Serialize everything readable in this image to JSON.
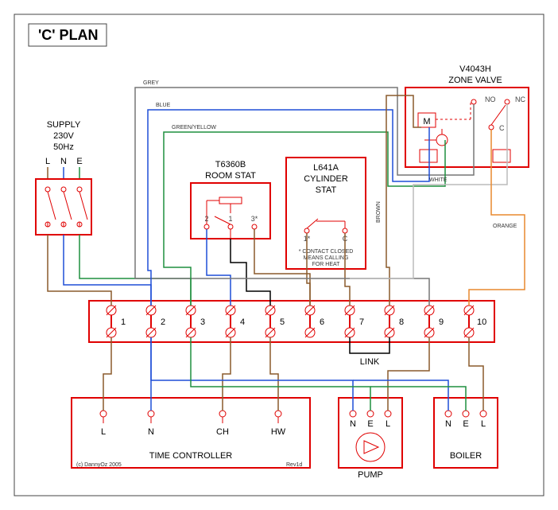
{
  "title": "'C' PLAN",
  "supply": {
    "label": "SUPPLY",
    "voltage": "230V",
    "freq": "50Hz",
    "L": "L",
    "N": "N",
    "E": "E"
  },
  "roomstat": {
    "label1": "T6360B",
    "label2": "ROOM STAT",
    "t1": "2",
    "t2": "1",
    "t3": "3*"
  },
  "cylstat": {
    "label1": "L641A",
    "label2": "CYLINDER",
    "label3": "STAT",
    "t1": "1*",
    "tC": "C",
    "note1": "* CONTACT CLOSED",
    "note2": "MEANS CALLING",
    "note3": "FOR HEAT"
  },
  "zone": {
    "label1": "V4043H",
    "label2": "ZONE VALVE",
    "M": "M",
    "NO": "NO",
    "NC": "NC",
    "C": "C"
  },
  "junction": {
    "terminals": [
      "1",
      "2",
      "3",
      "4",
      "5",
      "6",
      "7",
      "8",
      "9",
      "10"
    ],
    "link": "LINK"
  },
  "timecontroller": {
    "label": "TIME CONTROLLER",
    "L": "L",
    "N": "N",
    "CH": "CH",
    "HW": "HW",
    "copyright": "(c) DannyOz 2005",
    "rev": "Rev1d"
  },
  "pump": {
    "label": "PUMP",
    "N": "N",
    "E": "E",
    "L": "L"
  },
  "boiler": {
    "label": "BOILER",
    "N": "N",
    "E": "E",
    "L": "L"
  },
  "wirecolors": {
    "grey": "GREY",
    "blue": "BLUE",
    "greenyellow": "GREEN/YELLOW",
    "brown": "BROWN",
    "white": "WHITE",
    "orange": "ORANGE"
  }
}
